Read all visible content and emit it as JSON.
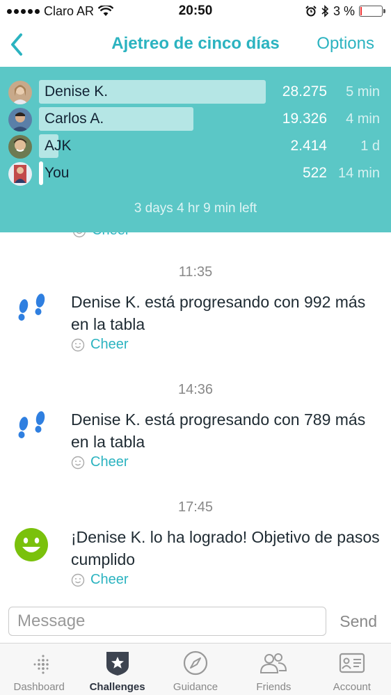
{
  "status_bar": {
    "carrier": "Claro AR",
    "time": "20:50",
    "battery": "3 %"
  },
  "nav": {
    "title": "Ajetreo de cinco días",
    "options_label": "Options"
  },
  "leaderboard": {
    "rows": [
      {
        "name": "Denise K.",
        "steps": "28.275",
        "time": "5 min",
        "progress": 1.0
      },
      {
        "name": "Carlos A.",
        "steps": "19.326",
        "time": "4 min",
        "progress": 0.68
      },
      {
        "name": "AJK",
        "steps": "2.414",
        "time": "1 d",
        "progress": 0.085
      },
      {
        "name": "You",
        "steps": "522",
        "time": "14 min",
        "progress": 0.018
      }
    ],
    "time_left": "3 days 4 hr 9 min left"
  },
  "feed": {
    "partial_cheer": "Cheer",
    "items": [
      {
        "timestamp": "11:35",
        "text": "Denise K. está progresando con 992 más en la tabla",
        "icon": "footsteps-icon",
        "cheer": "Cheer"
      },
      {
        "timestamp": "14:36",
        "text": "Denise K. está progresando con 789 más en la tabla",
        "icon": "footsteps-icon",
        "cheer": "Cheer"
      },
      {
        "timestamp": "17:45",
        "text": "¡Denise K. lo ha logrado! Objetivo de pasos cumplido",
        "icon": "smiley-face-icon",
        "cheer": "Cheer"
      }
    ]
  },
  "message": {
    "placeholder": "Message",
    "send_label": "Send"
  },
  "tabs": [
    {
      "label": "Dashboard",
      "icon": "dashboard-icon",
      "active": false
    },
    {
      "label": "Challenges",
      "icon": "challenges-icon",
      "active": true
    },
    {
      "label": "Guidance",
      "icon": "compass-icon",
      "active": false
    },
    {
      "label": "Friends",
      "icon": "friends-icon",
      "active": false
    },
    {
      "label": "Account",
      "icon": "account-card-icon",
      "active": false
    }
  ],
  "colors": {
    "accent": "#2bb3c0",
    "board_bg": "#5bc7c6",
    "footsteps": "#2f7fe0",
    "smiley": "#7ac10c"
  }
}
